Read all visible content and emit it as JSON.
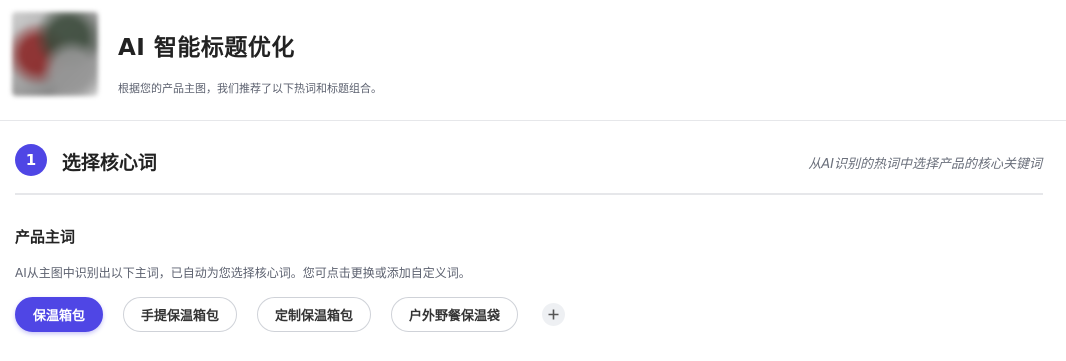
{
  "header": {
    "title": "AI 智能标题优化",
    "subtitle": "根据您的产品主图，我们推荐了以下热词和标题组合。"
  },
  "step1": {
    "number": "1",
    "title": "选择核心词",
    "hint": "从AI识别的热词中选择产品的核心关键词"
  },
  "main_words": {
    "label": "产品主词",
    "description": "AI从主图中识别出以下主词，已自动为您选择核心词。您可点击更换或添加自定义词。",
    "chips": [
      "保温箱包",
      "手提保温箱包",
      "定制保温箱包",
      "户外野餐保温袋"
    ],
    "selected": "保温箱包"
  },
  "colors": {
    "accent": "#4f46e5"
  },
  "icons": {
    "add": "plus-icon"
  }
}
